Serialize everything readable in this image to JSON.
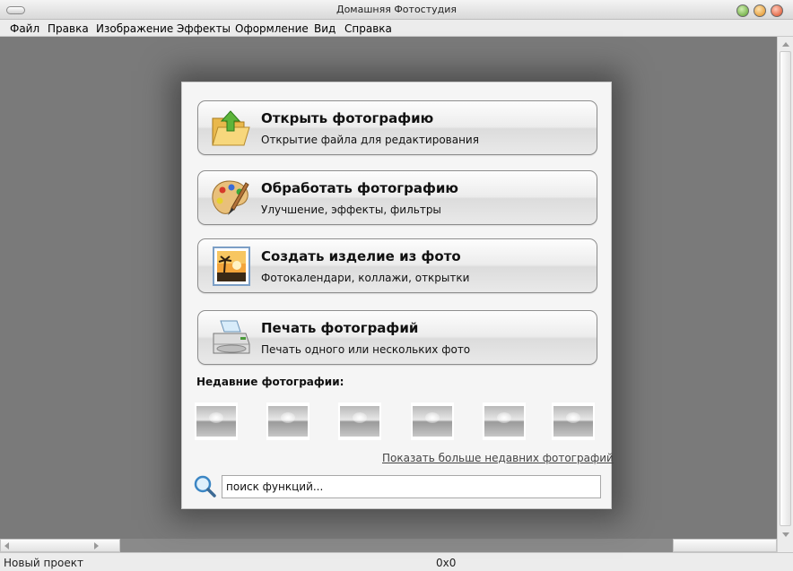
{
  "window": {
    "title": "Домашняя Фотостудия"
  },
  "menu": [
    "Файл",
    "Правка",
    "Изображение",
    "Эффекты",
    "Оформление",
    "Вид",
    "Справка"
  ],
  "dialog": {
    "actions": [
      {
        "title": "Открыть фотографию",
        "subtitle": "Открытие файла для редактирования",
        "icon": "folder-open-icon"
      },
      {
        "title": "Обработать фотографию",
        "subtitle": "Улучшение, эффекты, фильтры",
        "icon": "palette-icon"
      },
      {
        "title": "Создать изделие из фото",
        "subtitle": "Фотокалендари, коллажи, открытки",
        "icon": "photo-frame-icon"
      },
      {
        "title": "Печать фотографий",
        "subtitle": "Печать одного или нескольких фото",
        "icon": "printer-icon"
      }
    ],
    "recent_label": "Недавние фотографии:",
    "recent_count": 6,
    "more_link": "Показать больше недавних фотографий",
    "search": {
      "value": "поиск функций...",
      "icon": "search-icon"
    }
  },
  "status": {
    "left": "Новый проект",
    "center": "0x0"
  }
}
